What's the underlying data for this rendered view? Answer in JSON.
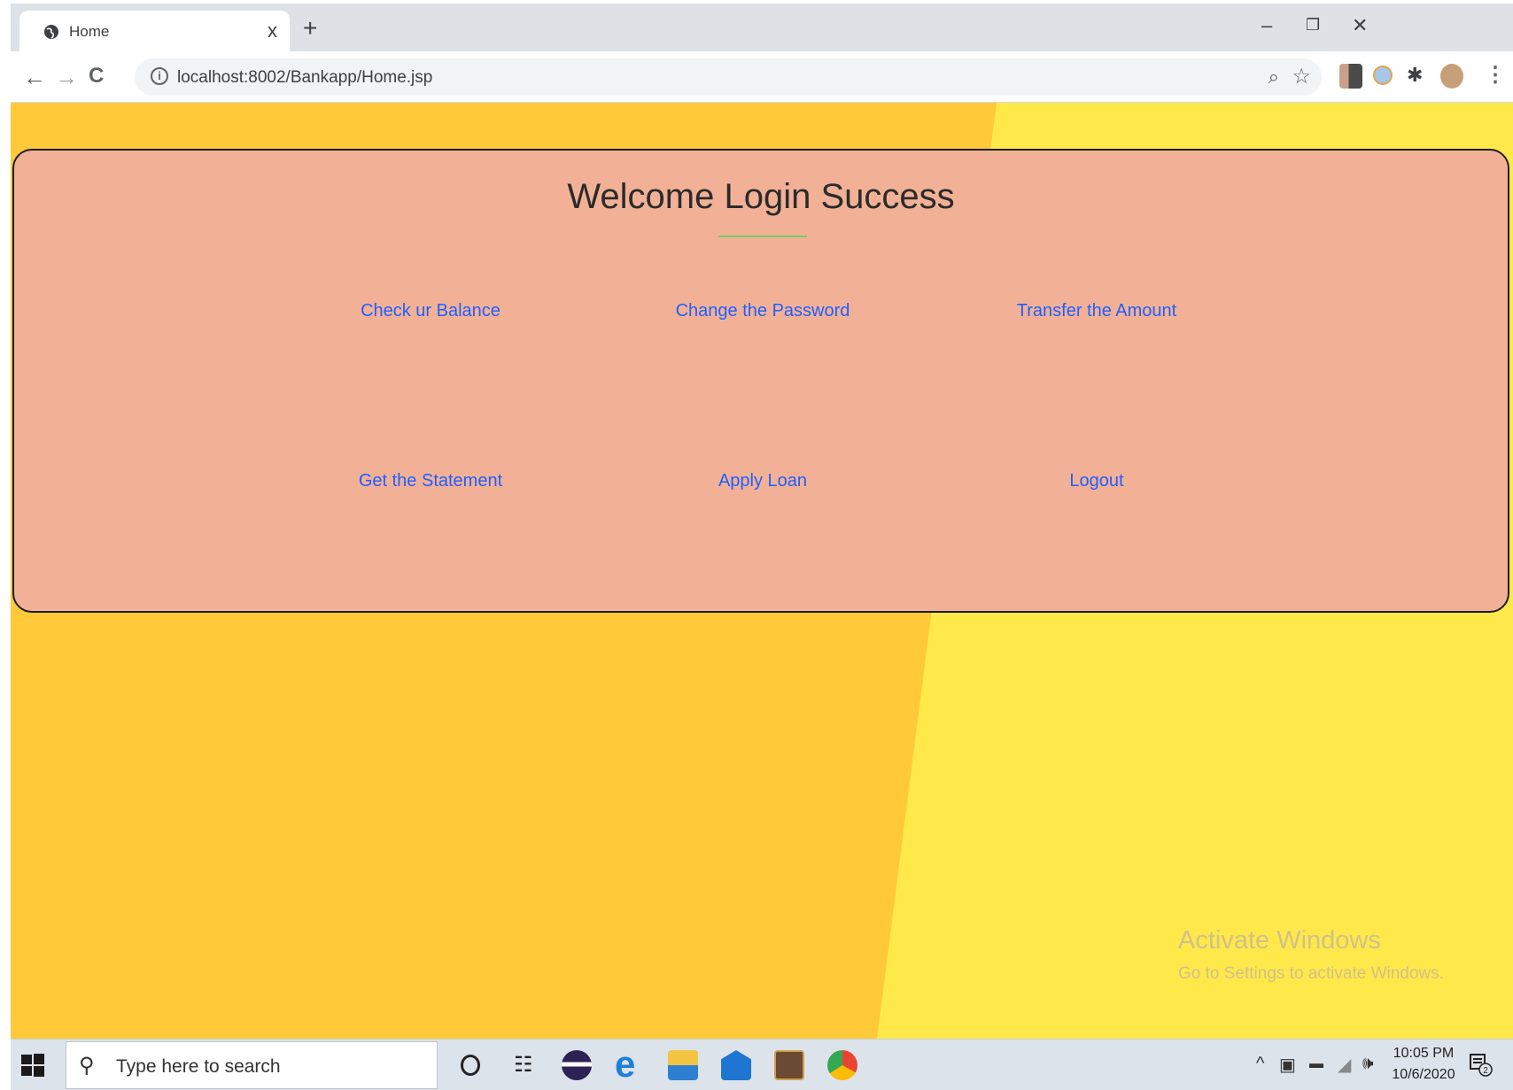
{
  "browser": {
    "tab_title": "Home",
    "tab_close": "x",
    "new_tab": "+",
    "window_controls": {
      "minimize": "–",
      "restore": "❐",
      "close": "✕"
    },
    "nav": {
      "back": "←",
      "forward": "→",
      "reload": "C"
    },
    "url": "localhost:8002/Bankapp/Home.jsp",
    "icons": [
      "globe-icon",
      "info-icon",
      "zoom-icon",
      "bookmark-star-icon",
      "extension-icons",
      "profile-avatar",
      "kebab-menu-icon"
    ]
  },
  "page": {
    "heading": "Welcome Login Success",
    "menu": [
      {
        "label": "Check ur Balance"
      },
      {
        "label": "Change the Password"
      },
      {
        "label": "Transfer the Amount"
      },
      {
        "label": "Get the Statement"
      },
      {
        "label": "Apply Loan"
      },
      {
        "label": "Logout"
      }
    ],
    "colors": {
      "card": "#f2b196",
      "link": "#1f5fff",
      "accent_line": "#7ac86a",
      "bg_orange": "#ffc93a",
      "bg_yellow": "#ffe94a"
    }
  },
  "watermark": {
    "line1": "Activate Windows",
    "line2": "Go to Settings to activate Windows."
  },
  "taskbar": {
    "search_placeholder": "Type here to search",
    "time": "10:05 PM",
    "date": "10/6/2020",
    "notification_count": "2",
    "apps": [
      "cortana-icon",
      "task-view-icon",
      "eclipse-icon",
      "edge-icon",
      "file-explorer-icon",
      "mail-icon",
      "app-icon",
      "chrome-icon"
    ]
  }
}
